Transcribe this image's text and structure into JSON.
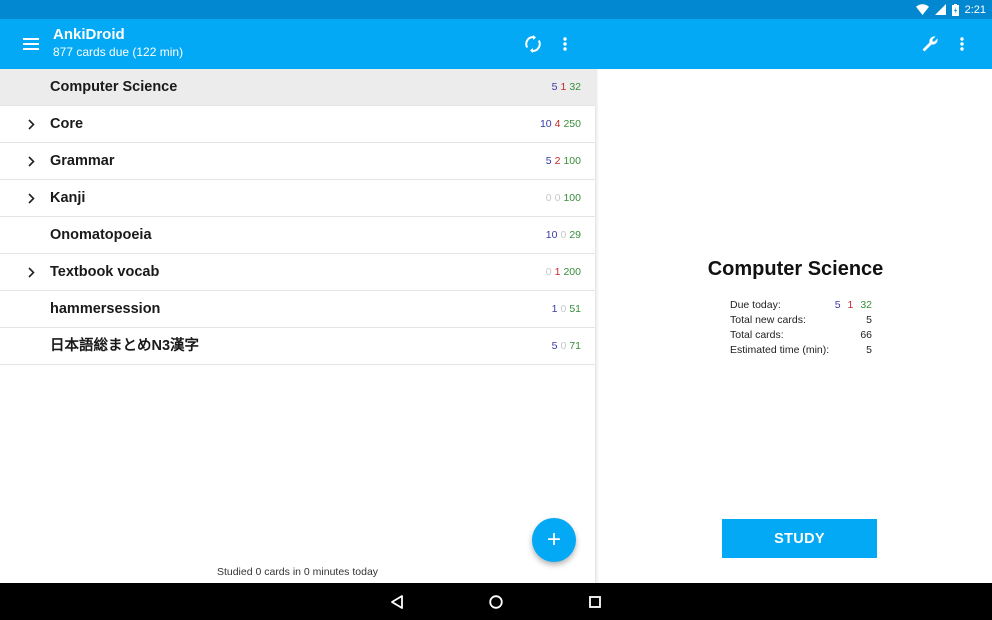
{
  "status_bar": {
    "time": "2:21",
    "icons": [
      "wifi-icon",
      "signal-icon",
      "battery-charging-icon"
    ]
  },
  "toolbar": {
    "title": "AnkiDroid",
    "subtitle": "877 cards due (122 min)",
    "icons": [
      "menu-icon",
      "sync-icon",
      "more-vert-icon",
      "wrench-icon",
      "more-vert-icon"
    ]
  },
  "decks": [
    {
      "name": "Computer Science",
      "expandable": false,
      "selected": true,
      "new": "5",
      "lrn": "1",
      "rev": "32"
    },
    {
      "name": "Core",
      "expandable": true,
      "selected": false,
      "new": "10",
      "lrn": "4",
      "rev": "250"
    },
    {
      "name": "Grammar",
      "expandable": true,
      "selected": false,
      "new": "5",
      "lrn": "2",
      "rev": "100"
    },
    {
      "name": "Kanji",
      "expandable": true,
      "selected": false,
      "new": "0",
      "lrn": "0",
      "rev": "100"
    },
    {
      "name": "Onomatopoeia",
      "expandable": false,
      "selected": false,
      "new": "10",
      "lrn": "0",
      "rev": "29"
    },
    {
      "name": "Textbook vocab",
      "expandable": true,
      "selected": false,
      "new": "0",
      "lrn": "1",
      "rev": "200"
    },
    {
      "name": "hammersession",
      "expandable": false,
      "selected": false,
      "new": "1",
      "lrn": "0",
      "rev": "51"
    },
    {
      "name": "日本語総まとめN3漢字",
      "expandable": false,
      "selected": false,
      "new": "5",
      "lrn": "0",
      "rev": "71"
    }
  ],
  "studied_text": "Studied 0 cards in 0 minutes today",
  "fab_label": "+",
  "overview": {
    "title": "Computer Science",
    "due_today_label": "Due today:",
    "due_today": {
      "new": "5",
      "lrn": "1",
      "rev": "32"
    },
    "total_new_label": "Total new cards:",
    "total_new": "5",
    "total_cards_label": "Total cards:",
    "total_cards": "66",
    "est_time_label": "Estimated time (min):",
    "est_time": "5",
    "study_button": "STUDY"
  },
  "nav_bar": {
    "icons": [
      "back-icon",
      "home-icon",
      "recents-icon"
    ]
  },
  "colors": {
    "accent": "#03a9f4",
    "status_bar": "#0288d1",
    "new": "#3a3aa8",
    "learning": "#c62828",
    "review": "#388e3c",
    "zero": "#c8c8c8"
  }
}
